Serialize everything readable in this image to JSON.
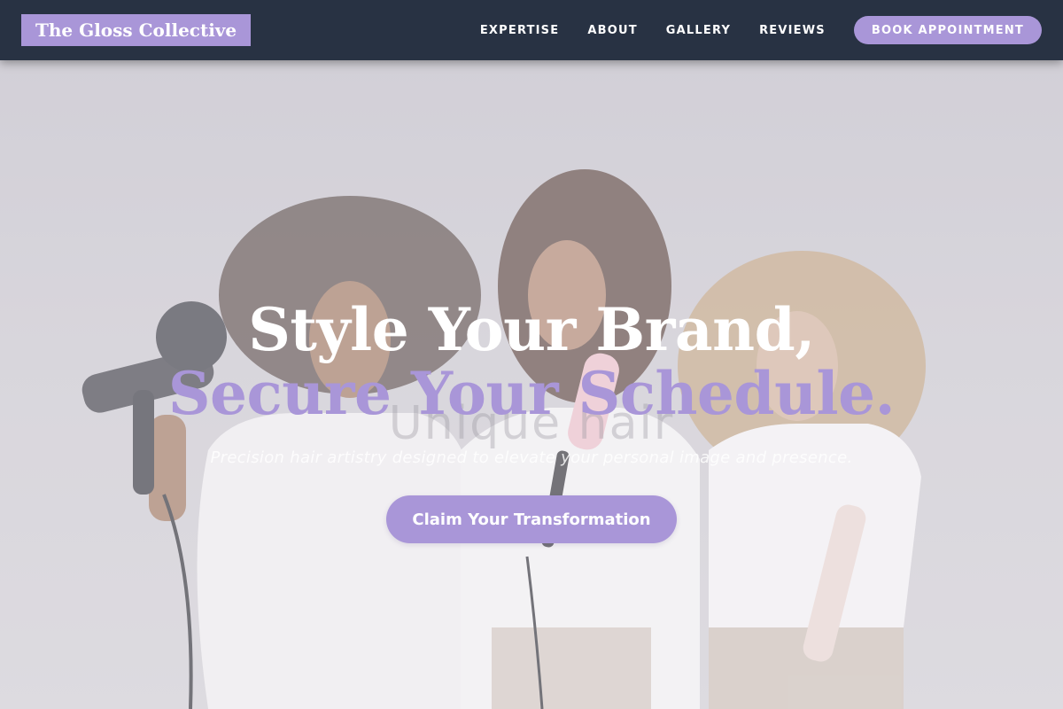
{
  "header": {
    "logo": "The Gloss Collective",
    "nav": [
      {
        "label": "EXPERTISE"
      },
      {
        "label": "ABOUT"
      },
      {
        "label": "GALLERY"
      },
      {
        "label": "REVIEWS"
      }
    ],
    "cta_label": "BOOK APPOINTMENT"
  },
  "hero": {
    "headline_line1": "Style Your Brand,",
    "headline_line2": "Secure Your Schedule.",
    "background_text": "Unique hair",
    "subheadline": "Precision hair artistry designed to elevate your personal image and presence.",
    "cta_label": "Claim Your Transformation",
    "photo_icon": "three-models-with-hair-tools-photo"
  },
  "colors": {
    "header_bg": "#283243",
    "accent": "#a996d8",
    "text_light": "#ffffff"
  }
}
